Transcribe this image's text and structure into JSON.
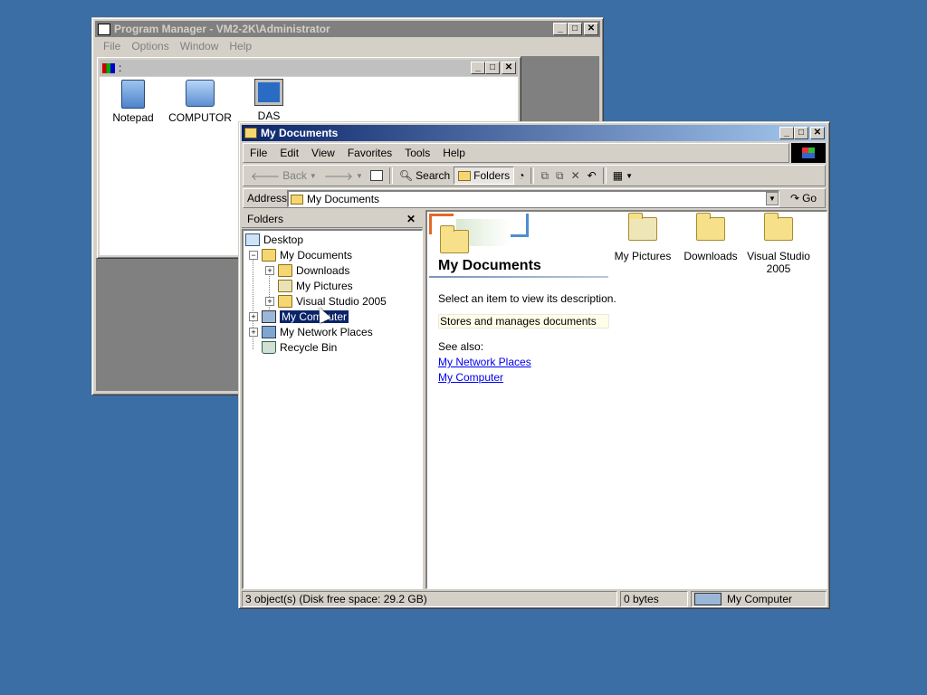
{
  "program_manager": {
    "title": "Program Manager - VM2-2K\\Administrator",
    "menu": [
      "File",
      "Options",
      "Window",
      "Help"
    ],
    "group_title": ":",
    "icons": [
      {
        "label": "Notepad",
        "icon": "notepad-icon"
      },
      {
        "label": "COMPUTOR",
        "icon": "computer-icon"
      },
      {
        "label": "DAS",
        "icon": "workstation-icon"
      }
    ]
  },
  "explorer": {
    "title": "My Documents",
    "menu": [
      "File",
      "Edit",
      "View",
      "Favorites",
      "Tools",
      "Help"
    ],
    "toolbar": {
      "back": "Back",
      "search": "Search",
      "folders": "Folders"
    },
    "address": {
      "label": "Address",
      "value": "My Documents",
      "go": "Go"
    },
    "folders_pane": {
      "title": "Folders",
      "tree": [
        {
          "label": "Desktop",
          "icon": "desktop-icon"
        },
        {
          "label": "My Documents",
          "icon": "my-documents-icon"
        },
        {
          "label": "Downloads",
          "icon": "folder-icon"
        },
        {
          "label": "My Pictures",
          "icon": "pictures-folder-icon"
        },
        {
          "label": "Visual Studio 2005",
          "icon": "folder-icon"
        },
        {
          "label": "My Computer",
          "icon": "my-computer-icon",
          "selected": true
        },
        {
          "label": "My Network Places",
          "icon": "network-icon"
        },
        {
          "label": "Recycle Bin",
          "icon": "recycle-bin-icon"
        }
      ]
    },
    "web_view": {
      "heading": "My Documents",
      "prompt": "Select an item to view its description.",
      "description": "Stores and manages documents",
      "see_also": "See also:",
      "links": [
        "My Network Places",
        "My Computer"
      ]
    },
    "items": [
      {
        "label": "My Pictures",
        "icon": "pictures-folder-icon"
      },
      {
        "label": "Downloads",
        "icon": "folder-icon"
      },
      {
        "label": "Visual Studio 2005",
        "icon": "folder-icon"
      }
    ],
    "status": {
      "objects": "3 object(s) (Disk free space: 29.2 GB)",
      "size": "0 bytes",
      "location": "My Computer"
    }
  },
  "colors": {
    "desktop": "#3a6ea5",
    "active_title": "#0a246a",
    "inactive_title": "#808080",
    "selection": "#0a246a"
  }
}
